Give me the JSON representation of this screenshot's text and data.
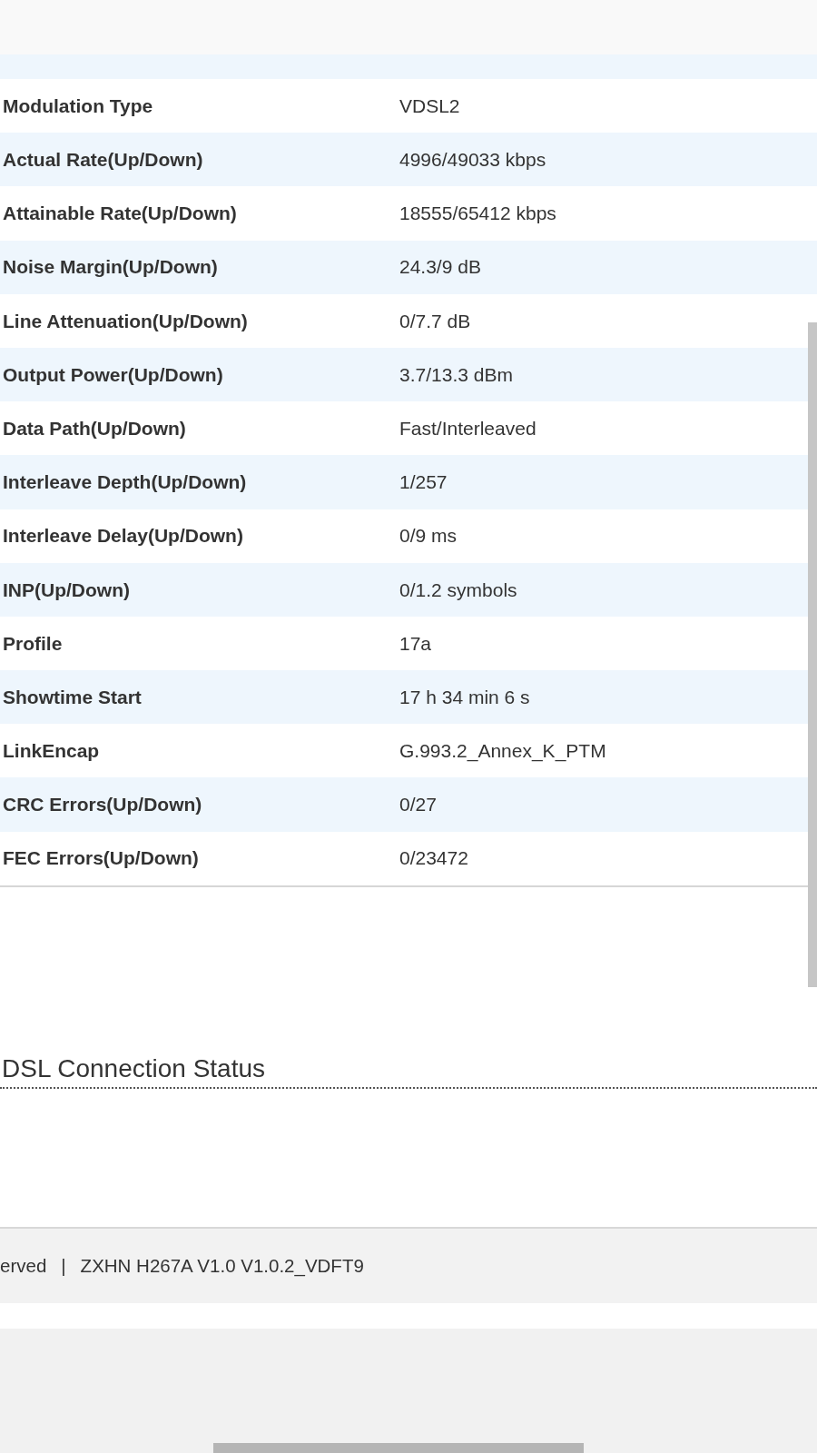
{
  "table": {
    "rows": [
      {
        "label": "Modulation Type",
        "value": "VDSL2"
      },
      {
        "label": "Actual Rate(Up/Down)",
        "value": "4996/49033 kbps"
      },
      {
        "label": "Attainable Rate(Up/Down)",
        "value": "18555/65412 kbps"
      },
      {
        "label": "Noise Margin(Up/Down)",
        "value": "24.3/9 dB"
      },
      {
        "label": "Line Attenuation(Up/Down)",
        "value": "0/7.7 dB"
      },
      {
        "label": "Output Power(Up/Down)",
        "value": "3.7/13.3 dBm"
      },
      {
        "label": "Data Path(Up/Down)",
        "value": "Fast/Interleaved"
      },
      {
        "label": "Interleave Depth(Up/Down)",
        "value": "1/257"
      },
      {
        "label": "Interleave Delay(Up/Down)",
        "value": "0/9 ms"
      },
      {
        "label": "INP(Up/Down)",
        "value": "0/1.2 symbols"
      },
      {
        "label": "Profile",
        "value": "17a"
      },
      {
        "label": "Showtime Start",
        "value": "17 h 34 min 6 s"
      },
      {
        "label": "LinkEncap",
        "value": "G.993.2_Annex_K_PTM"
      },
      {
        "label": "CRC Errors(Up/Down)",
        "value": "0/27"
      },
      {
        "label": "FEC Errors(Up/Down)",
        "value": "0/23472"
      }
    ]
  },
  "section_title": "DSL Connection Status",
  "footer": {
    "rights_fragment": "erved",
    "separator": "|",
    "version": "ZXHN H267A V1.0 V1.0.2_VDFT9"
  }
}
